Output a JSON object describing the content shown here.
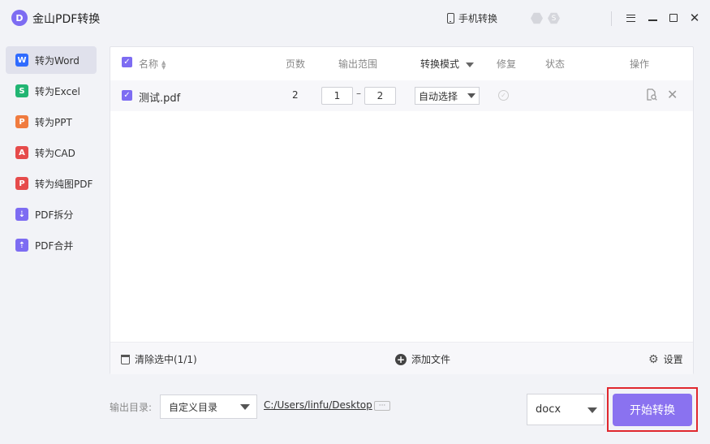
{
  "app": {
    "logo_letter": "D",
    "title": "金山PDF转换"
  },
  "titlebar": {
    "mobile_convert_label": "手机转换",
    "hex_icon_1": "hex-badge",
    "hex_icon_2": "hex-s",
    "hex_icon_2_text": "S"
  },
  "sidebar": {
    "items": [
      {
        "label": "转为Word",
        "icon_letter": "W",
        "color": "#2f6bff",
        "active": true
      },
      {
        "label": "转为Excel",
        "icon_letter": "S",
        "color": "#22b573"
      },
      {
        "label": "转为PPT",
        "icon_letter": "P",
        "color": "#f07b3f"
      },
      {
        "label": "转为CAD",
        "icon_letter": "A",
        "color": "#e64b4b"
      },
      {
        "label": "转为纯图PDF",
        "icon_letter": "P",
        "color": "#e64b4b"
      },
      {
        "label": "PDF拆分",
        "icon_letter": "⇣",
        "color": "#7d6cf2"
      },
      {
        "label": "PDF合并",
        "icon_letter": "⇡",
        "color": "#7d6cf2"
      }
    ]
  },
  "table": {
    "headers": {
      "name": "名称",
      "pages": "页数",
      "range": "输出范围",
      "mode": "转换模式",
      "repair": "修复",
      "status": "状态",
      "actions": "操作"
    },
    "rows": [
      {
        "checked": true,
        "name": "测试.pdf",
        "pages": "2",
        "range_from": "1",
        "range_to": "2",
        "range_sep": "–",
        "mode": "自动选择",
        "status": ""
      }
    ]
  },
  "footer": {
    "clear_label": "清除选中(1/1)",
    "add_label": "添加文件",
    "settings_label": "设置"
  },
  "output": {
    "label": "输出目录:",
    "dir_option": "自定义目录",
    "path": "C:/Users/linfu/Desktop",
    "more": "···",
    "format": "docx",
    "start_label": "开始转换"
  },
  "colors": {
    "accent": "#7d6cf2",
    "highlight": "#e0282e",
    "start_button": "#8a72f0"
  }
}
